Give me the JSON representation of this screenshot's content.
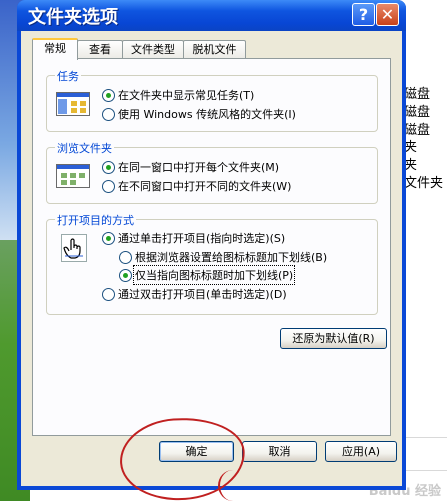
{
  "background": {
    "items": [
      "磁盘",
      "磁盘",
      "磁盘",
      "夹",
      "夹",
      "文件夹"
    ],
    "watermark": "Baidu 经验"
  },
  "dialog": {
    "title": "文件夹选项",
    "help_glyph": "?",
    "close_glyph": "✕",
    "tabs": [
      {
        "label": "常规",
        "active": true
      },
      {
        "label": "查看",
        "active": false
      },
      {
        "label": "文件类型",
        "active": false
      },
      {
        "label": "脱机文件",
        "active": false
      }
    ],
    "tasks": {
      "group_label": "任务",
      "icon": "window-preview-icon",
      "options": [
        {
          "label": "在文件夹中显示常见任务(T)",
          "selected": true
        },
        {
          "label": "使用 Windows 传统风格的文件夹(I)",
          "selected": false
        }
      ]
    },
    "browse": {
      "group_label": "浏览文件夹",
      "icon": "window-preview-icon",
      "options": [
        {
          "label": "在同一窗口中打开每个文件夹(M)",
          "selected": true
        },
        {
          "label": "在不同窗口中打开不同的文件夹(W)",
          "selected": false
        }
      ]
    },
    "click": {
      "group_label": "打开项目的方式",
      "icon": "hand-pointer-icon",
      "options": [
        {
          "label": "通过单击打开项目(指向时选定)(S)",
          "selected": true
        },
        {
          "label": "根据浏览器设置给图标标题加下划线(B)",
          "selected": false
        },
        {
          "label": "仅当指向图标标题时加下划线(P)",
          "selected": true
        },
        {
          "label": "通过双击打开项目(单击时选定)(D)",
          "selected": false
        }
      ]
    },
    "restore_label": "还原为默认值(R)",
    "ok_label": "确定",
    "cancel_label": "取消",
    "apply_label": "应用(A)",
    "colors": {
      "titlebar": "#0a48d6",
      "face": "#ece9d8",
      "group_label": "#0046d5",
      "annotation": "#c02020"
    }
  }
}
